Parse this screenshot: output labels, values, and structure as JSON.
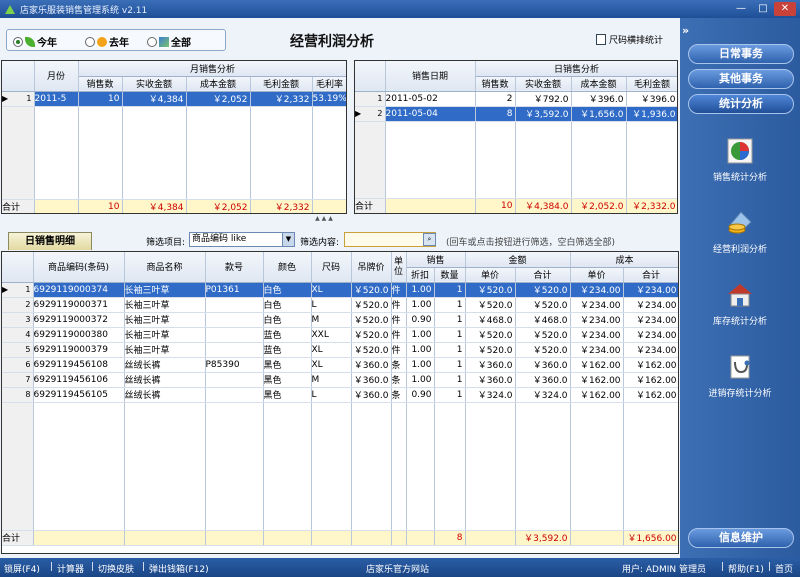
{
  "window": {
    "title": "店家乐服装销售管理系统 v2.11",
    "min": "—",
    "max": "□",
    "close": "✕"
  },
  "filter": {
    "options": [
      {
        "label": "今年",
        "selected": true,
        "icon": "leaf-icon"
      },
      {
        "label": "去年",
        "selected": false,
        "icon": "sun-icon"
      },
      {
        "label": "全部",
        "selected": false,
        "icon": "cube-icon"
      }
    ]
  },
  "page_title": "经营利润分析",
  "size_button": "尺码横排统计",
  "month_grid": {
    "group_header": "月销售分析",
    "col_month": "月份",
    "cols": [
      "销售数",
      "实收金额",
      "成本金额",
      "毛利金额",
      "毛利率"
    ],
    "rows": [
      {
        "idx": "1",
        "month": "2011-5",
        "qty": "10",
        "received": "￥4,384",
        "cost": "￥2,052",
        "profit": "￥2,332",
        "rate": "53.19%"
      }
    ],
    "total": {
      "label": "合计",
      "qty": "10",
      "received": "￥4,384",
      "cost": "￥2,052",
      "profit": "￥2,332"
    }
  },
  "day_grid": {
    "group_header": "日销售分析",
    "col_date": "销售日期",
    "cols": [
      "销售数",
      "实收金额",
      "成本金额",
      "毛利金额"
    ],
    "rows": [
      {
        "idx": "1",
        "date": "2011-05-02",
        "qty": "2",
        "received": "￥792.0",
        "cost": "￥396.0",
        "profit": "￥396.0"
      },
      {
        "idx": "2",
        "date": "2011-05-04",
        "qty": "8",
        "received": "￥3,592.0",
        "cost": "￥1,656.0",
        "profit": "￥1,936.0"
      }
    ],
    "total": {
      "label": "合计",
      "qty": "10",
      "received": "￥4,384.0",
      "cost": "￥2,052.0",
      "profit": "￥2,332.0"
    }
  },
  "detail": {
    "tab": "日销售明细",
    "filter_label": "筛选项目:",
    "filter_value": "商品编码 like",
    "content_label": "筛选内容:",
    "content_value": "",
    "hint": "(回车或点击按钮进行筛选，空白筛选全部)",
    "headers": {
      "code": "商品编码(条码)",
      "name": "商品名称",
      "style": "款号",
      "color": "颜色",
      "size": "尺码",
      "tag": "吊牌价",
      "unit": "单位",
      "sale": "销售",
      "discount": "折扣",
      "qty": "数量",
      "amount": "金额",
      "amount_price": "单价",
      "amount_total": "合计",
      "cost": "成本",
      "cost_price": "单价",
      "cost_total": "合计"
    },
    "rows": [
      {
        "idx": "1",
        "code": "6929119000374",
        "name": "长袖三叶草",
        "style": "P01361",
        "color": "白色",
        "size": "XL",
        "tag": "￥520.0",
        "unit": "件",
        "discount": "1.00",
        "qty": "1",
        "price": "￥520.0",
        "total": "￥520.0",
        "cprice": "￥234.00",
        "ctotal": "￥234.00"
      },
      {
        "idx": "2",
        "code": "6929119000371",
        "name": "长袖三叶草",
        "style": "",
        "color": "白色",
        "size": "L",
        "tag": "￥520.0",
        "unit": "件",
        "discount": "1.00",
        "qty": "1",
        "price": "￥520.0",
        "total": "￥520.0",
        "cprice": "￥234.00",
        "ctotal": "￥234.00"
      },
      {
        "idx": "3",
        "code": "6929119000372",
        "name": "长袖三叶草",
        "style": "",
        "color": "白色",
        "size": "M",
        "tag": "￥520.0",
        "unit": "件",
        "discount": "0.90",
        "qty": "1",
        "price": "￥468.0",
        "total": "￥468.0",
        "cprice": "￥234.00",
        "ctotal": "￥234.00"
      },
      {
        "idx": "4",
        "code": "6929119000380",
        "name": "长袖三叶草",
        "style": "",
        "color": "蓝色",
        "size": "XXL",
        "tag": "￥520.0",
        "unit": "件",
        "discount": "1.00",
        "qty": "1",
        "price": "￥520.0",
        "total": "￥520.0",
        "cprice": "￥234.00",
        "ctotal": "￥234.00"
      },
      {
        "idx": "5",
        "code": "6929119000379",
        "name": "长袖三叶草",
        "style": "",
        "color": "蓝色",
        "size": "XL",
        "tag": "￥520.0",
        "unit": "件",
        "discount": "1.00",
        "qty": "1",
        "price": "￥520.0",
        "total": "￥520.0",
        "cprice": "￥234.00",
        "ctotal": "￥234.00"
      },
      {
        "idx": "6",
        "code": "6929119456108",
        "name": "丝绒长裤",
        "style": "P85390",
        "color": "黑色",
        "size": "XL",
        "tag": "￥360.0",
        "unit": "条",
        "discount": "1.00",
        "qty": "1",
        "price": "￥360.0",
        "total": "￥360.0",
        "cprice": "￥162.00",
        "ctotal": "￥162.00"
      },
      {
        "idx": "7",
        "code": "6929119456106",
        "name": "丝绒长裤",
        "style": "",
        "color": "黑色",
        "size": "M",
        "tag": "￥360.0",
        "unit": "条",
        "discount": "1.00",
        "qty": "1",
        "price": "￥360.0",
        "total": "￥360.0",
        "cprice": "￥162.00",
        "ctotal": "￥162.00"
      },
      {
        "idx": "8",
        "code": "6929119456105",
        "name": "丝绒长裤",
        "style": "",
        "color": "黑色",
        "size": "L",
        "tag": "￥360.0",
        "unit": "条",
        "discount": "0.90",
        "qty": "1",
        "price": "￥324.0",
        "total": "￥324.0",
        "cprice": "￥162.00",
        "ctotal": "￥162.00"
      }
    ],
    "total": {
      "label": "合计",
      "qty": "8",
      "total": "￥3,592.0",
      "ctotal": "￥1,656.00"
    }
  },
  "sidebar": {
    "collapse": "»",
    "buttons": [
      "日常事务",
      "其他事务",
      "统计分析"
    ],
    "items": [
      {
        "label": "销售统计分析",
        "icon": "pie-chart-icon"
      },
      {
        "label": "经营利润分析",
        "icon": "coins-icon"
      },
      {
        "label": "库存统计分析",
        "icon": "warehouse-icon"
      },
      {
        "label": "进销存统计分析",
        "icon": "stethoscope-icon"
      }
    ],
    "bottom_button": "信息维护"
  },
  "statusbar": {
    "lock": "锁屏(F4)",
    "calc": "计算器",
    "skin": "切换皮肤",
    "cashbox": "弹出钱箱(F12)",
    "site": "店家乐官方网站",
    "user": "用户: ADMIN 管理员",
    "help": "帮助(F1)",
    "home": "首页"
  },
  "colors": {
    "selected_row": "#2f6bc7",
    "total_text": "#cc0000",
    "sidebar": "#2c5b9f"
  }
}
